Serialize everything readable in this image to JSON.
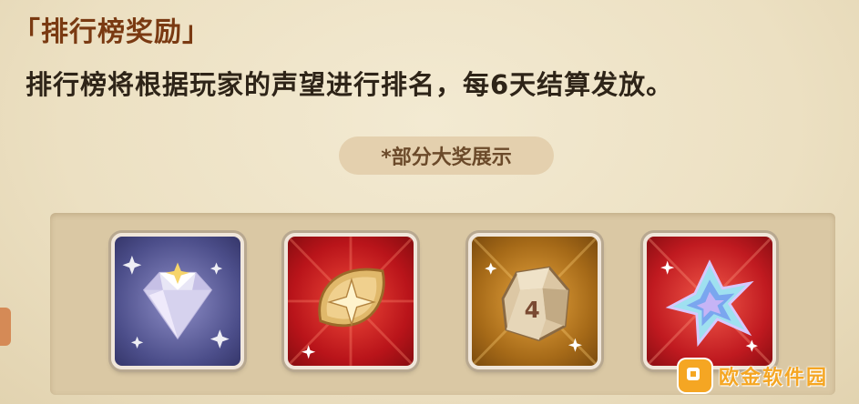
{
  "header": {
    "title": "「排行榜奖励」",
    "description": "排行榜将根据玩家的声望进行排名，每6天结算发放。"
  },
  "showcase": {
    "label": "*部分大奖展示",
    "items": [
      {
        "icon": "diamond-icon",
        "frame": "purple"
      },
      {
        "icon": "golden-emblem-icon",
        "frame": "red"
      },
      {
        "icon": "ore-stone-4-icon",
        "badge": "4",
        "frame": "gold"
      },
      {
        "icon": "shuriken-crystal-icon",
        "frame": "red"
      }
    ]
  },
  "watermark": {
    "text": "欧金软件园"
  },
  "colors": {
    "title": "#7a3a12",
    "text": "#2e2418",
    "pill_bg": "#e4d0ae",
    "panel_bg": "#dac8a4"
  }
}
